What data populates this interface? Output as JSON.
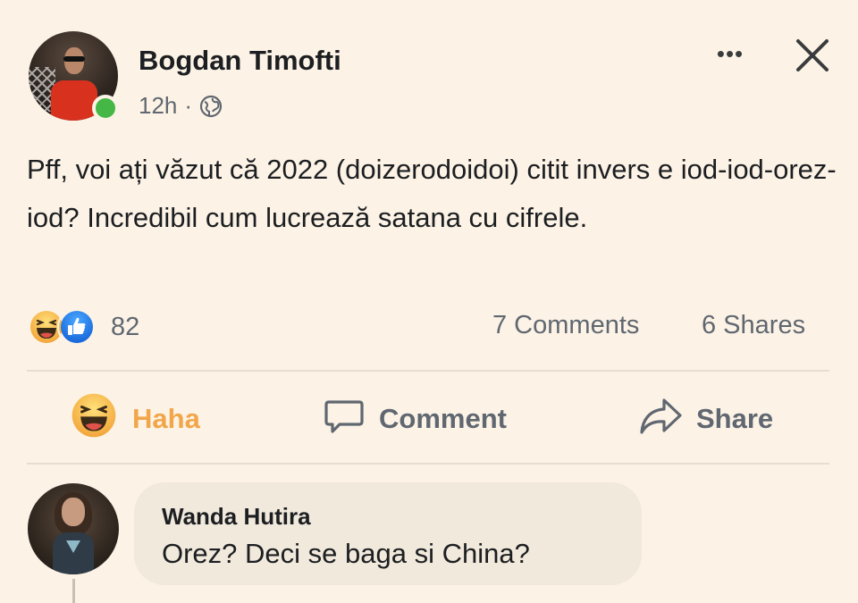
{
  "post": {
    "author": "Bogdan Timofti",
    "time": "12h",
    "meta_separator": "·",
    "privacy_icon": "globe-icon",
    "more_icon": "•••",
    "text": "Pff, voi ați văzut că 2022 (doizerodoidoi) citit invers e iod-iod-orez-iod? Incredibil cum lucrează satana cu cifrele.",
    "online_status_color": "#44b746"
  },
  "summary": {
    "reaction_icons": [
      "haha-icon",
      "like-icon"
    ],
    "reaction_count": "82",
    "comments": "7 Comments",
    "shares": "6 Shares"
  },
  "actions": {
    "haha_label": "Haha",
    "comment_label": "Comment",
    "share_label": "Share",
    "haha_color": "#f1a64a",
    "default_color": "#606770"
  },
  "comment": {
    "author": "Wanda Hutira",
    "text": "Orez? Deci se baga si China?"
  },
  "colors": {
    "background": "#fcf3e6",
    "bubble": "#f1e9dc",
    "text": "#1c1e21",
    "muted": "#606770"
  }
}
